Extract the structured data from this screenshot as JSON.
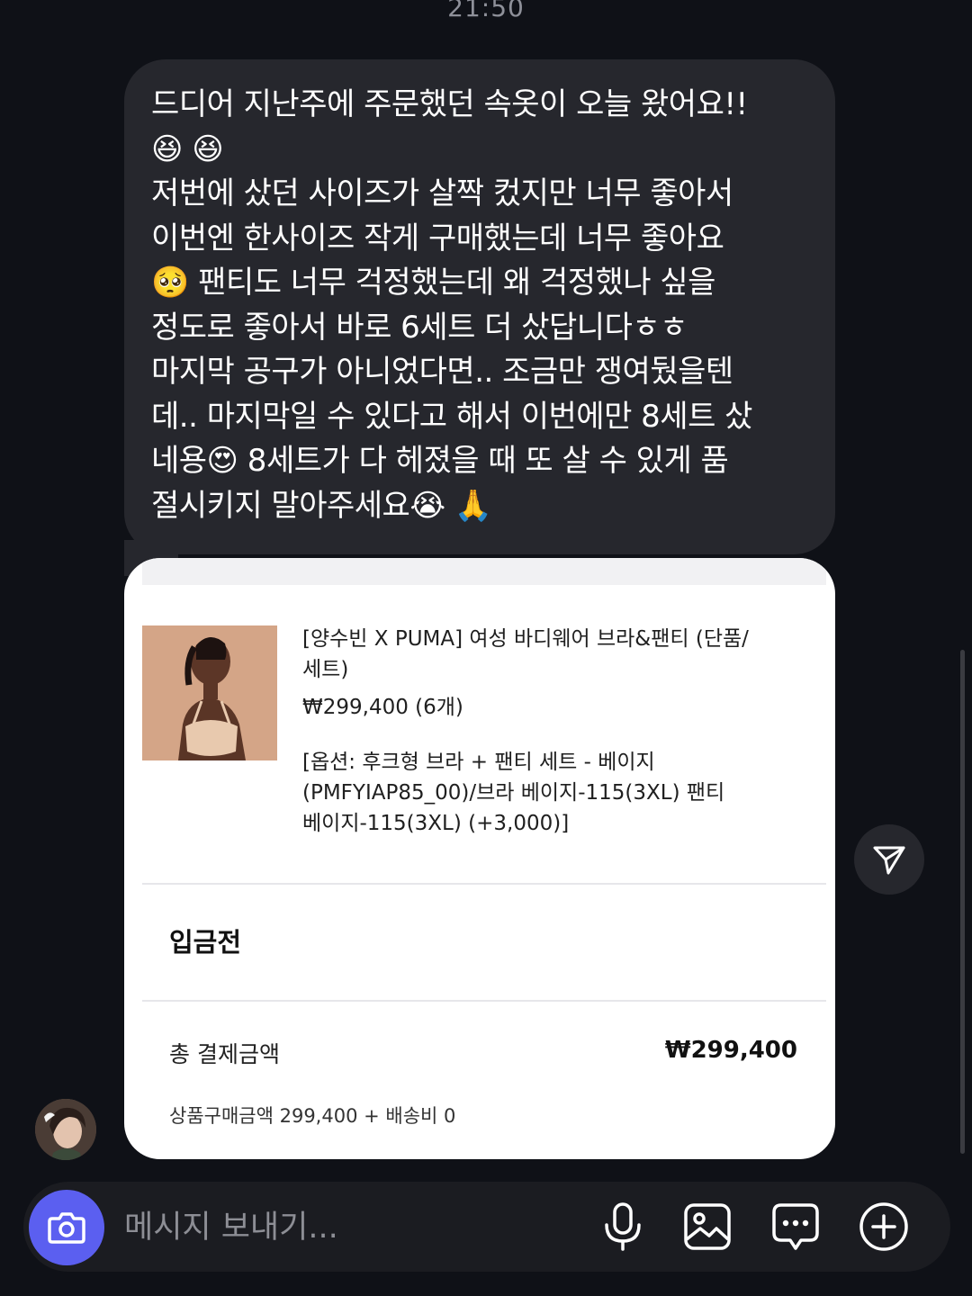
{
  "status_bar": {
    "time": "21:50"
  },
  "message": {
    "text": "드디어 지난주에 주문했던 속옷이 오늘 왔어요!!\n😆 😆\n저번에 샀던 사이즈가 살짝 컸지만 너무 좋아서\n이번엔 한사이즈 작게 구매했는데 너무 좋아요\n🥺 팬티도 너무 걱정했는데 왜 걱정했나 싶을\n정도로 좋아서 바로 6세트 더 샀답니다ㅎㅎ\n마지막 공구가 아니었다면.. 조금만 쟁여뒀을텐\n데.. 마지막일 수 있다고 해서 이번에만 8세트 샀\n네용😍 8세트가 다 헤졌을 때 또 살 수 있게 품\n절시키지 말아주세요😭 🙏"
  },
  "order_card": {
    "product_name": "[양수빈 X PUMA] 여성 바디웨어 브라&팬티 (단품/세트)",
    "price": "₩299,400 (6개)",
    "option": "[옵션: 후크형 브라 + 팬티 세트 - 베이지 (PMFYIAP85_00)/브라 베이지-115(3XL) 팬티 베이지-115(3XL) (+3,000)]",
    "status": "입금전",
    "total_label": "총 결제금액",
    "total_amount": "₩299,400",
    "breakdown": "상품구매금액 299,400 + 배송비 0"
  },
  "composer": {
    "placeholder": "메시지 보내기..."
  },
  "icons": {
    "share": "paper-plane-icon",
    "camera": "camera-icon",
    "mic": "microphone-icon",
    "gallery": "image-icon",
    "sticker": "chat-bubble-icon",
    "add": "plus-circle-icon"
  },
  "colors": {
    "background": "#0f1117",
    "bubble": "#26272d",
    "card": "#ffffff",
    "camera_button": "#5b5ff0"
  }
}
